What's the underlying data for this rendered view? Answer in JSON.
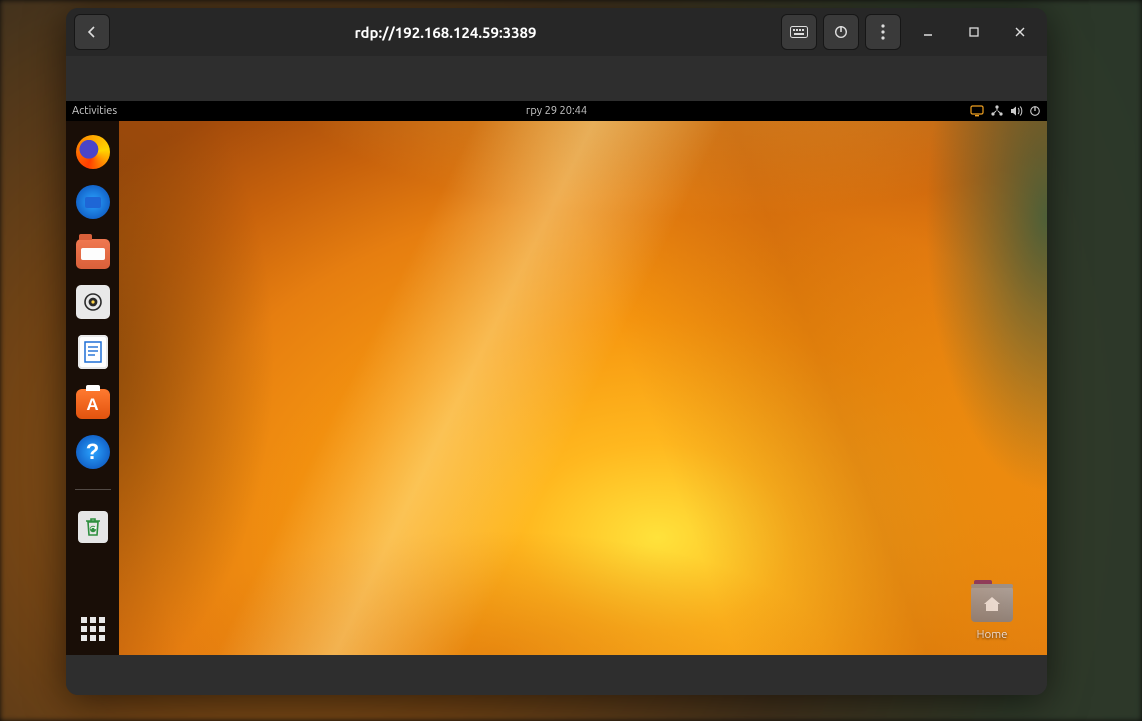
{
  "titlebar": {
    "address": "rdp://192.168.124.59:3389"
  },
  "panel": {
    "activities": "Activities",
    "clock": "гру 29  20:44"
  },
  "dock": {
    "items": [
      {
        "id": "firefox",
        "name": "Firefox",
        "type": "firefox"
      },
      {
        "id": "thunderbird",
        "name": "Thunderbird",
        "type": "thunderbird"
      },
      {
        "id": "files",
        "name": "Files",
        "type": "files"
      },
      {
        "id": "rhythmbox",
        "name": "Rhythmbox",
        "type": "rhythm"
      },
      {
        "id": "writer",
        "name": "LibreOffice Writer",
        "type": "writer"
      },
      {
        "id": "software",
        "name": "Ubuntu Software",
        "type": "software"
      },
      {
        "id": "help",
        "name": "Help",
        "type": "help"
      },
      {
        "id": "trash",
        "name": "Trash",
        "type": "trash"
      }
    ],
    "show_apps": "Show Applications"
  },
  "desktop": {
    "home_label": "Home"
  },
  "colors": {
    "window_bg": "#2e2e2e",
    "titlebar_bg": "#272727",
    "panel_bg": "#000000",
    "accent": "#e95420"
  }
}
